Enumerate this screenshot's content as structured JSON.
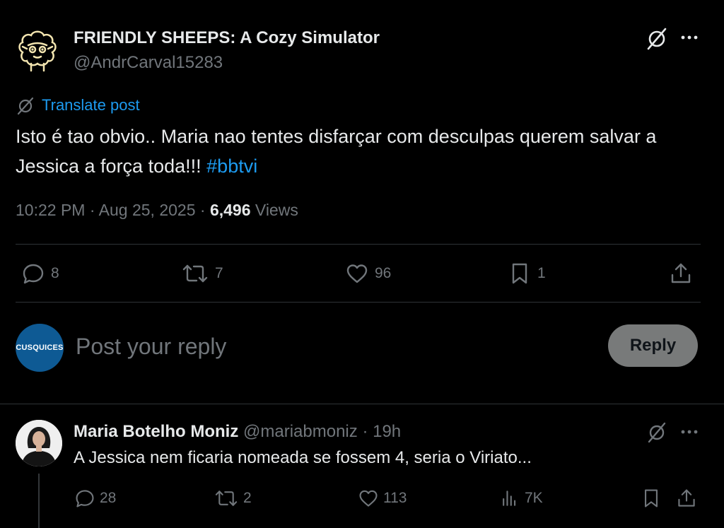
{
  "post": {
    "author_name": "FRIENDLY SHEEPS: A Cozy Simulator",
    "author_handle": "@AndrCarval15283",
    "translate_label": "Translate post",
    "text": "Isto é tao obvio.. Maria nao tentes disfarçar com desculpas querem salvar a Jessica a força toda!!!",
    "hashtag": "#bbtvi",
    "time": "10:22 PM",
    "date": "Aug 25, 2025",
    "views_count": "6,496",
    "views_label": "Views",
    "separator": "·"
  },
  "actions": {
    "replies": "8",
    "reposts": "7",
    "likes": "96",
    "bookmarks": "1"
  },
  "composer": {
    "avatar_text": "CUSQUICES",
    "placeholder": "Post your reply",
    "reply_button": "Reply"
  },
  "reply": {
    "author_name": "Maria Botelho Moniz",
    "author_handle": "@mariabmoniz",
    "age": "19h",
    "separator": "·",
    "text": "A Jessica nem ficaria nomeada se fossem 4, seria o Viriato...",
    "replies": "28",
    "reposts": "2",
    "likes": "113",
    "views": "7K"
  },
  "colors": {
    "background": "#000000",
    "text": "#e7e9ea",
    "muted": "#71767b",
    "link": "#1d9bf0",
    "divider": "#2f3336",
    "reply_button_bg": "#787a7a"
  }
}
